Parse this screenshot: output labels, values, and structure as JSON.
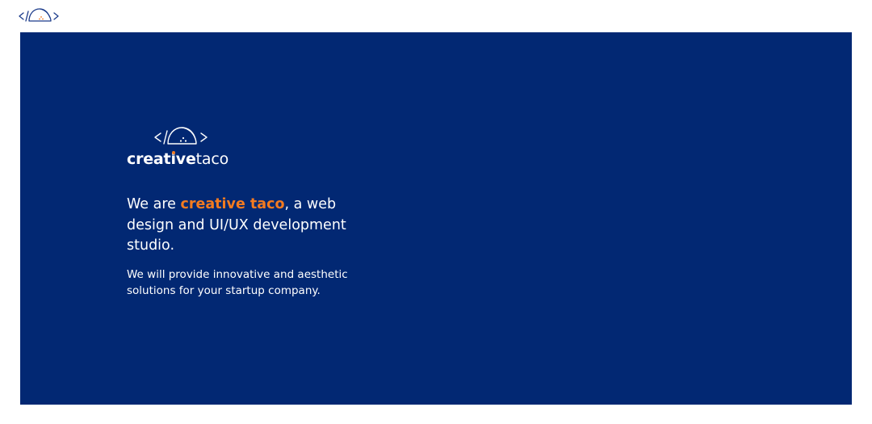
{
  "header": {
    "logo_icon": "code-taco-logo-icon"
  },
  "hero": {
    "brand_icon": "code-taco-logo-icon",
    "wordmark": {
      "part1_bold": "creat",
      "part2_i": "i",
      "part3_bold": "ve",
      "part4_light": "taco"
    },
    "headline": {
      "before": "We are ",
      "accent": "creative taco",
      "after": ", a web design and UI/UX development studio."
    },
    "subtext": "We will provide innovative and aesthetic solutions for your startup company."
  },
  "colors": {
    "hero_background": "#022873",
    "accent": "#f47b20",
    "logo_blue": "#1a3a8a",
    "text_on_hero": "#ffffff"
  }
}
